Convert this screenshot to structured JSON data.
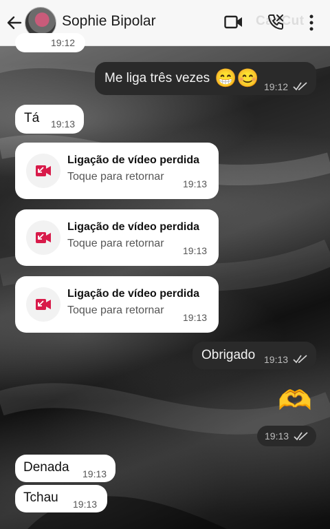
{
  "header": {
    "contact_name": "Sophie Bipolar",
    "watermark": "CapCut",
    "icons": [
      "back-arrow-icon",
      "avatar",
      "video-camera-icon",
      "phone-icon",
      "more-vert-icon"
    ]
  },
  "messages": {
    "partial_top_time": "19:12",
    "m1": {
      "text": "Me liga três vezes",
      "emojis": "😁😊",
      "time": "19:12",
      "read": true
    },
    "m2": {
      "text": "Tá",
      "time": "19:13"
    },
    "calls": [
      {
        "title": "Ligação de vídeo perdida",
        "subtitle": "Toque para retornar",
        "time": "19:13"
      },
      {
        "title": "Ligação de vídeo perdida",
        "subtitle": "Toque para retornar",
        "time": "19:13"
      },
      {
        "title": "Ligação de vídeo perdida",
        "subtitle": "Toque para retornar",
        "time": "19:13"
      }
    ],
    "m3": {
      "text": "Obrigado",
      "time": "19:13",
      "read": true
    },
    "m4": {
      "emoji": "🫶",
      "time": "19:13",
      "read": true
    },
    "m5": {
      "text": "Denada",
      "time": "19:13"
    },
    "m6": {
      "text": "Tchau",
      "time": "19:13"
    }
  },
  "colors": {
    "incoming_bubble": "#ffffff",
    "outgoing_bubble": "#2a2a2a",
    "missed_call_red": "#d81b4a"
  }
}
